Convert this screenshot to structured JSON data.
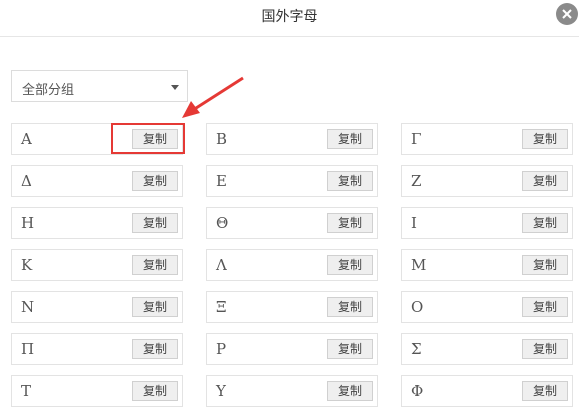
{
  "dialog": {
    "title": "国外字母"
  },
  "group_select": {
    "value": "全部分组"
  },
  "copy_label": "复制",
  "letters": [
    [
      "A",
      "B",
      "Γ"
    ],
    [
      "Δ",
      "E",
      "Z"
    ],
    [
      "H",
      "Θ",
      "I"
    ],
    [
      "K",
      "Λ",
      "M"
    ],
    [
      "N",
      "Ξ",
      "O"
    ],
    [
      "Π",
      "P",
      "Σ"
    ],
    [
      "T",
      "Υ",
      "Φ"
    ]
  ],
  "annotation_color": "#e53935"
}
